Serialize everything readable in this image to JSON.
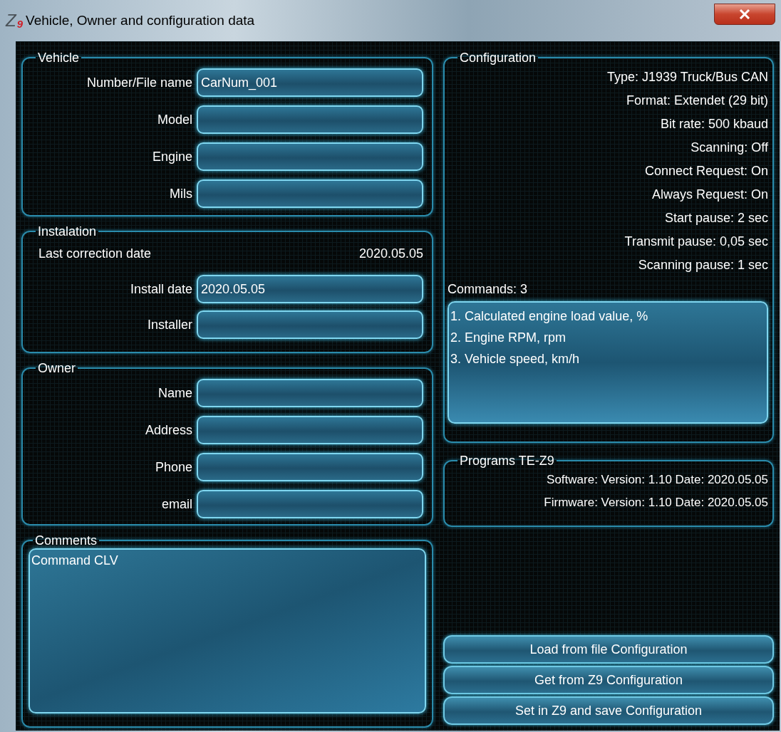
{
  "window": {
    "title": "Vehicle, Owner and configuration data",
    "logo": {
      "letter": "Z",
      "digit": "9"
    }
  },
  "vehicle": {
    "legend": "Vehicle",
    "rows": [
      {
        "kind": "field",
        "label": "Number/File name",
        "value": "CarNum_001"
      },
      {
        "kind": "field",
        "label": "Model"
      },
      {
        "kind": "field",
        "label": "Engine"
      },
      {
        "kind": "field",
        "label": "Mils"
      }
    ]
  },
  "installation": {
    "legend": "Instalation",
    "rows": [
      {
        "kind": "static",
        "label": "Last correction date",
        "value": "2020.05.05"
      },
      {
        "kind": "field",
        "label": "Install date",
        "value": "2020.05.05"
      },
      {
        "kind": "field",
        "label": "Installer"
      }
    ]
  },
  "owner": {
    "legend": "Owner",
    "rows": [
      {
        "kind": "field",
        "label": "Name"
      },
      {
        "kind": "field",
        "label": "Address"
      },
      {
        "kind": "field",
        "label": "Phone"
      },
      {
        "kind": "field",
        "label": "email"
      }
    ]
  },
  "comments": {
    "legend": "Comments",
    "value": "Command CLV"
  },
  "configuration": {
    "legend": "Configuration",
    "lines": [
      "Type: J1939 Truck/Bus CAN",
      "Format: Extendet (29 bit)",
      "Bit rate: 500 kbaud",
      "Scanning: Off",
      "Connect Request: On",
      "Always Request: On",
      "Start pause: 2 sec",
      "Transmit pause: 0,05 sec",
      "Scanning pause: 1 sec"
    ],
    "commands_label": "Commands: 3",
    "commands": [
      "1. Calculated engine load value, %",
      "2. Engine RPM, rpm",
      "3. Vehicle speed, km/h"
    ]
  },
  "programs": {
    "legend": "Programs TE-Z9",
    "lines": [
      "Software: Version: 1.10 Date: 2020.05.05",
      "Firmware: Version: 1.10 Date: 2020.05.05"
    ]
  },
  "buttons": [
    "Load from file Configuration",
    "Get from Z9 Configuration",
    "Set in Z9 and save Configuration"
  ]
}
